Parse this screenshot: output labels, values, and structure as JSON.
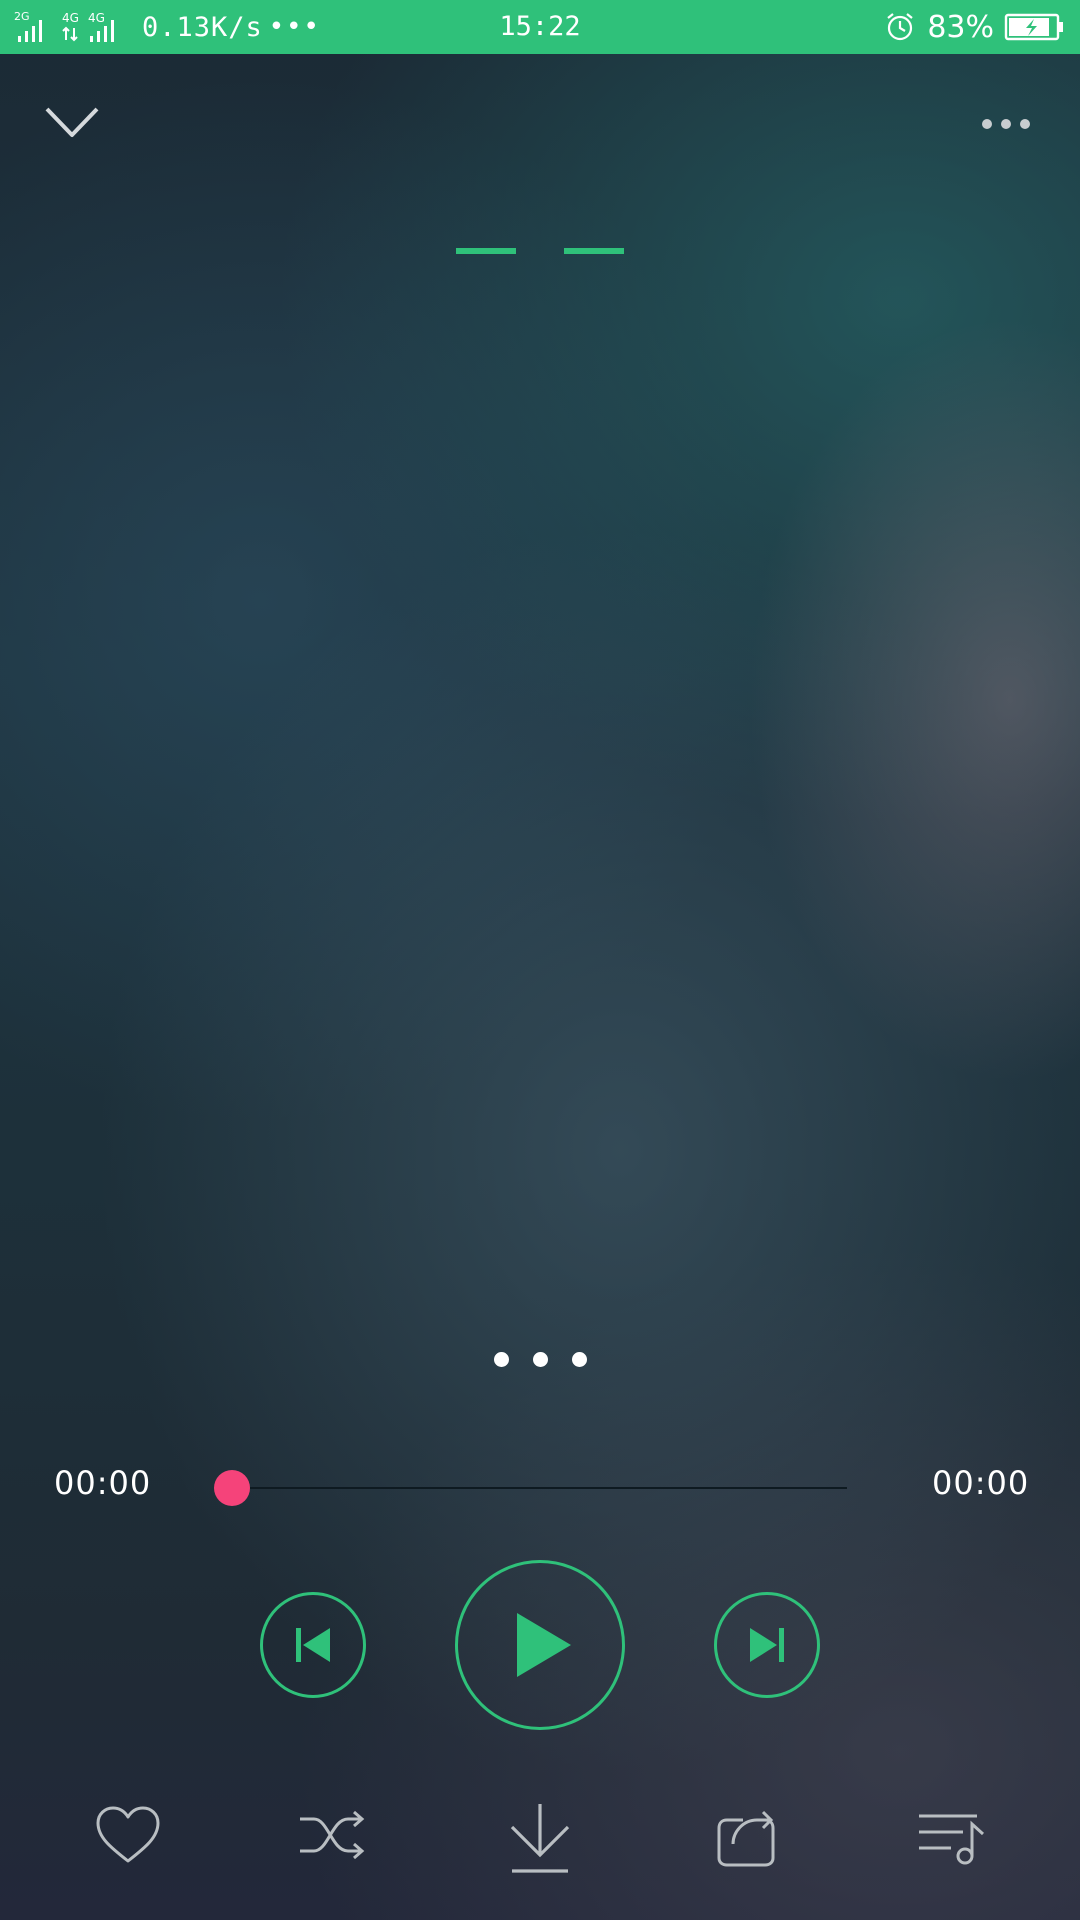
{
  "status_bar": {
    "network_2g": "2G",
    "network_4g_a": "4G",
    "network_4g_b": "4G",
    "speed": "0.13K/s",
    "more": "•••",
    "time": "15:22",
    "battery_percent": "83%",
    "alarm_icon": "alarm-clock-icon",
    "battery_icon": "battery-charging-icon",
    "bg_color": "#2fc17a"
  },
  "header": {
    "collapse_icon": "chevron-down-icon",
    "more_icon": "more-dots-icon"
  },
  "pager": {
    "count": 3
  },
  "progress": {
    "elapsed": "00:00",
    "total": "00:00",
    "fraction": 0.0,
    "thumb_color": "#f5437a"
  },
  "controls": {
    "prev_icon": "skip-previous-icon",
    "play_icon": "play-icon",
    "next_icon": "skip-next-icon",
    "accent_color": "#2fc17a"
  },
  "bottom_bar": {
    "items": [
      "heart-icon",
      "shuffle-icon",
      "download-icon",
      "repeat-icon",
      "playlist-icon"
    ]
  }
}
